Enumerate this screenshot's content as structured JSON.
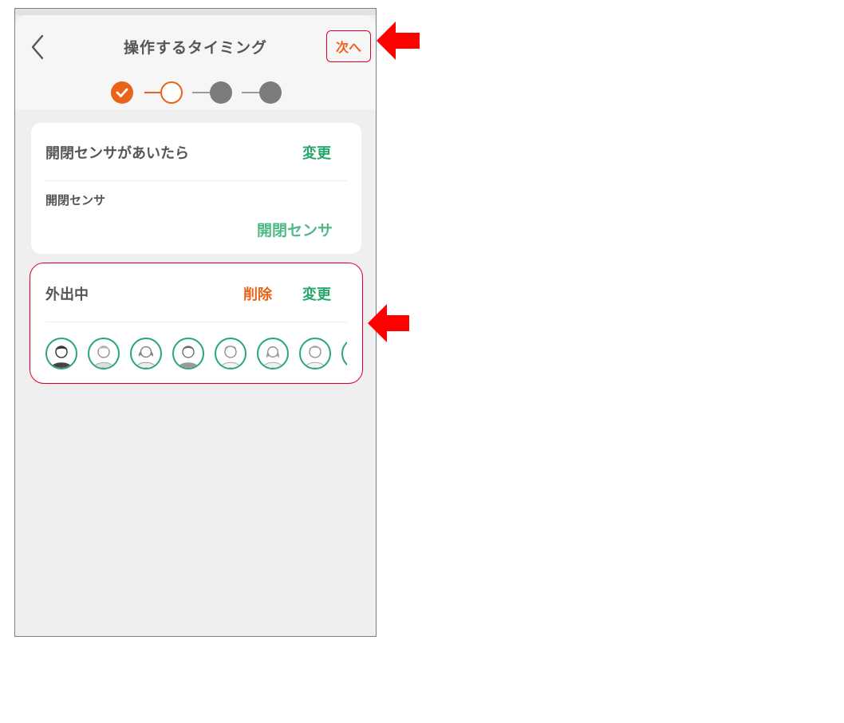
{
  "header": {
    "title": "操作するタイミング",
    "next_label": "次へ",
    "back_icon": "chevron-left-icon"
  },
  "stepper": {
    "steps": [
      "done",
      "current",
      "todo",
      "todo"
    ]
  },
  "trigger_card": {
    "title": "開閉センサがあいたら",
    "change_label": "変更",
    "sensor_label": "開閉センサ",
    "sensor_value": "開閉センサ"
  },
  "condition_card": {
    "title": "外出中",
    "delete_label": "削除",
    "change_label": "変更",
    "avatars": [
      "dark-male",
      "boy",
      "girl",
      "man",
      "elder-man",
      "woman",
      "senior",
      "partial"
    ]
  },
  "colors": {
    "accent_orange": "#e86418",
    "accent_green": "#27a86f",
    "annotation_red": "#e0002a"
  },
  "annotations": {
    "arrow_icon": "left-arrow-icon"
  }
}
